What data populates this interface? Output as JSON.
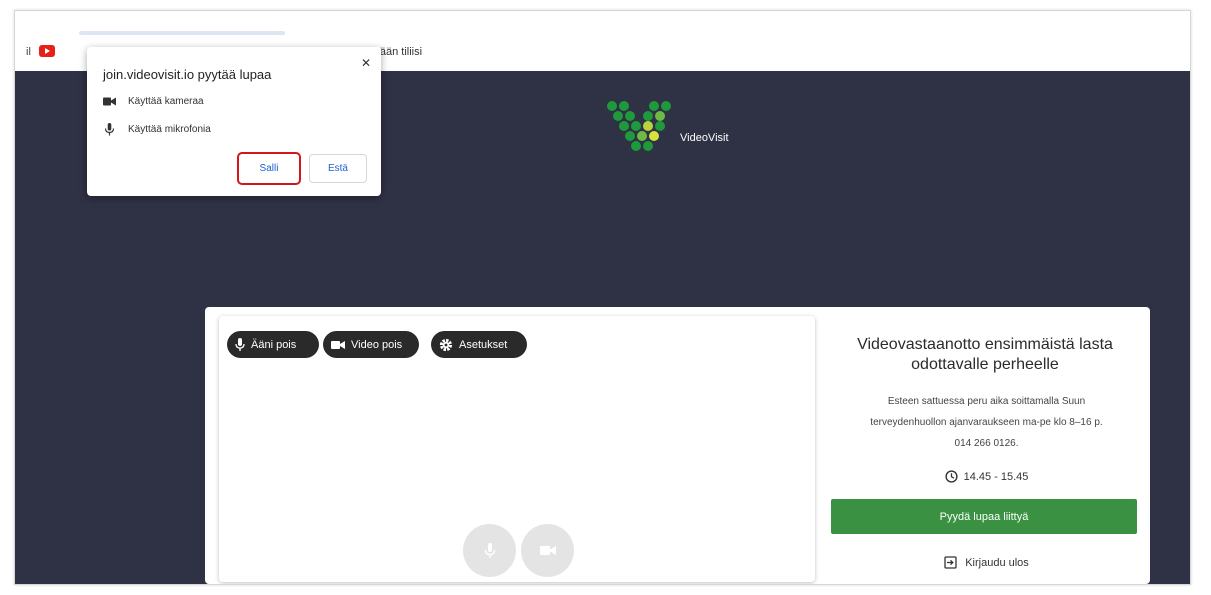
{
  "bookmarks": {
    "left_text": "il",
    "login_text": "udu sisään tiliisi"
  },
  "permission_popup": {
    "title": "join.videovisit.io pyytää lupaa",
    "close_glyph": "✕",
    "camera_label": "Käyttää kameraa",
    "microphone_label": "Käyttää mikrofonia",
    "allow_label": "Salli",
    "block_label": "Estä"
  },
  "brand": {
    "name": "VideoVisit"
  },
  "controls": {
    "audio_off": "Ääni pois",
    "video_off": "Video pois",
    "settings": "Asetukset"
  },
  "info": {
    "title": "Videovastaanotto ensimmäistä lasta odottavalle perheelle",
    "body_line1": "Esteen sattuessa peru aika soittamalla Suun",
    "body_line2": "terveydenhuollon ajanvaraukseen ma-pe klo 8–16 p.",
    "body_line3": "014 266 0126.",
    "time": "14.45 - 15.45",
    "join_button": "Pyydä lupaa liittyä",
    "logout": "Kirjaudu ulos"
  },
  "colors": {
    "page_background": "#2f3145",
    "join_button": "#3a9142",
    "allow_highlight": "#d4161a",
    "link_blue": "#1a62d1"
  }
}
